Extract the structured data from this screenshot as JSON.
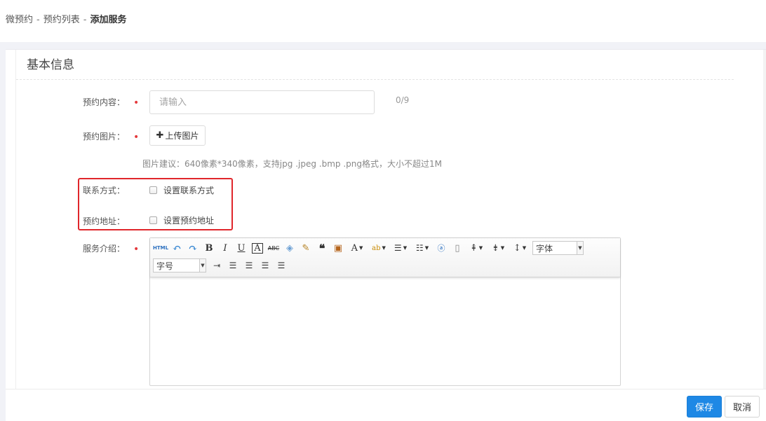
{
  "breadcrumb": {
    "items": [
      "微预约",
      "预约列表"
    ],
    "separator": "-",
    "current": "添加服务"
  },
  "section": {
    "title": "基本信息"
  },
  "form": {
    "content": {
      "label": "预约内容：",
      "placeholder": "请输入",
      "counter": "0/9",
      "required": true
    },
    "image": {
      "label": "预约图片：",
      "upload_label": "上传图片",
      "hint": "图片建议：640像素*340像素，支持jpg .jpeg .bmp .png格式，大小不超过1M",
      "required": true
    },
    "contact": {
      "label": "联系方式：",
      "checkbox_label": "设置联系方式",
      "checked": false
    },
    "address": {
      "label": "预约地址：",
      "checkbox_label": "设置预约地址",
      "checked": false
    },
    "intro": {
      "label": "服务介绍：",
      "required": true,
      "font_family_select": "字体",
      "font_size_select": "字号",
      "toolbar_icons": [
        "html-icon",
        "undo-icon",
        "redo-icon",
        "bold-icon",
        "italic-icon",
        "underline-icon",
        "font-border-icon",
        "strikethrough-icon",
        "eraser-icon",
        "format-brush-icon",
        "blockquote-icon",
        "paste-plain-icon",
        "font-color-icon",
        "back-color-icon",
        "ordered-list-icon",
        "unordered-list-icon",
        "link-icon",
        "blank-page-icon",
        "row-spacing-top-icon",
        "row-spacing-bottom-icon",
        "line-height-icon",
        "indent-icon",
        "align-left-icon",
        "align-center-icon",
        "align-right-icon",
        "align-justify-icon"
      ]
    }
  },
  "buttons": {
    "save": "保存",
    "cancel": "取消"
  },
  "colors": {
    "primary": "#1e88e5",
    "required": "#e4393c",
    "highlight_box": "#e0262b"
  }
}
